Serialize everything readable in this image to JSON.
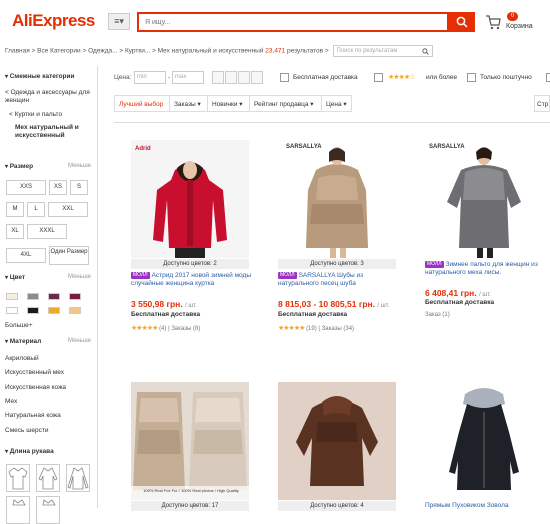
{
  "header": {
    "logo": "AliExpress",
    "menu_icon": "≡▾",
    "search_placeholder": "Я ищу...",
    "cart_count": "0",
    "cart_label": "Корзина"
  },
  "breadcrumb": {
    "items": [
      "Главная",
      "Все Категории",
      "Одежда...",
      "Куртки...",
      "Мех натуральный и искусственный"
    ],
    "count": "23,471",
    "results_label": "результатов",
    "search_placeholder": "Поиск по результатам"
  },
  "sidebar": {
    "related_title": "Смежные категории",
    "related_parent": "< Одежда и аксессуары для женщин",
    "related_sub": "< Куртки и пальто",
    "related_current": "Мех натуральный и искусственный",
    "size_title": "Размер",
    "less_label": "Меньше",
    "sizes": [
      "XXS",
      "XS",
      "S",
      "M",
      "L",
      "XXL",
      "XL",
      "XXXL",
      "4XL",
      "Один Размер"
    ],
    "color_title": "Цвет",
    "colors": [
      "#f4eedc",
      "#8b8b8b",
      "#6b2a4a",
      "#7a1c3c",
      "#ffffff",
      "#1a1a1a",
      "#f2a82a",
      "#f4c58a"
    ],
    "more_label": "Больше+",
    "material_title": "Материал",
    "materials": [
      "Акриловый",
      "Искусственный мех",
      "Искусственная кожа",
      "Мех",
      "Натуральная кожа",
      "Смесь шерсти"
    ],
    "sleeve_title": "Длина рукава"
  },
  "filters": {
    "price_label": "Цена:",
    "min_placeholder": "min",
    "max_placeholder": "max",
    "free_shipping": "Бесплатная доставка",
    "stars_label": "★★★★☆",
    "or_more": "или более",
    "wholesale_only": "Только поштучно"
  },
  "sort": {
    "best_match": "Лучший выбор",
    "orders": "Заказы ▾",
    "newest": "Новинки ▾",
    "seller_rating": "Рейтинг продавца ▾",
    "price": "Цена ▾",
    "ship_to": "Стр"
  },
  "products": [
    {
      "brand": "Adrid",
      "colors": "Доступно цветов: 2",
      "mall": "МОЛЛ",
      "title": "Астрид 2017 новой зимней моды случайные женщина куртка",
      "price": "3 550,98 грн.",
      "unit": "/ шт.",
      "shipping": "Бесплатная доставка",
      "stars": "★★★★★",
      "reviews": "(4)",
      "orders": "Заказы (8)"
    },
    {
      "brand": "SARSALLYA",
      "colors": "Доступно цветов: 3",
      "mall": "МОЛЛ",
      "title": "SARSALLYA Шубы из натурального песец шуба",
      "price": "8 815,03 - 10 805,51 грн.",
      "unit": "/ шт.",
      "shipping": "Бесплатная доставка",
      "stars": "★★★★★",
      "reviews": "(19)",
      "orders": "Заказы (34)"
    },
    {
      "brand": "SARSALLYA",
      "colors": "",
      "mall": "МОЛЛ",
      "title": "Зимнее пальто для женщин из натурального меха лисы.",
      "price": "6 408,41 грн.",
      "unit": "/ шт.",
      "shipping": "Бесплатная доставка",
      "stars": "",
      "reviews": "",
      "orders": "Заказ (1)"
    },
    {
      "brand": "",
      "colors": "Доступно цветов: 17",
      "mall": "",
      "title": "",
      "price": "",
      "unit": "",
      "shipping": "",
      "stars": "",
      "reviews": "",
      "orders": "",
      "watermark": "100% Real Fox Fur / 100% Real photos / High Quality"
    },
    {
      "brand": "",
      "colors": "Доступно цветов: 4",
      "mall": "",
      "title": "",
      "price": "",
      "unit": "",
      "shipping": "",
      "stars": "",
      "reviews": "",
      "orders": ""
    },
    {
      "brand": "",
      "colors": "",
      "mall": "",
      "title": "Прямым Пуховиком Зовола",
      "price": "",
      "unit": "",
      "shipping": "",
      "stars": "",
      "reviews": "",
      "orders": ""
    }
  ]
}
